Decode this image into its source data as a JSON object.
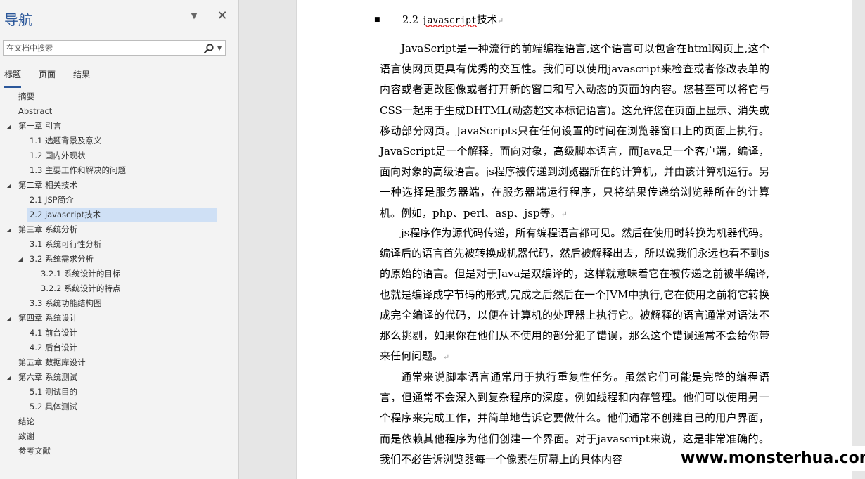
{
  "nav": {
    "title": "导航",
    "close": "✕",
    "menu": "▼",
    "search_placeholder": "在文档中搜索",
    "search_dropdown": "▼",
    "tabs": [
      "标题",
      "页面",
      "结果"
    ],
    "active_tab": "标题",
    "items": [
      {
        "label": "摘要",
        "level": 1
      },
      {
        "label": "Abstract",
        "level": 1
      },
      {
        "label": "第一章 引言",
        "level": 1,
        "expanded": true
      },
      {
        "label": "1.1 选题背景及意义",
        "level": 2
      },
      {
        "label": "1.2 国内外现状",
        "level": 2
      },
      {
        "label": "1.3 主要工作和解决的问题",
        "level": 2
      },
      {
        "label": "第二章 相关技术",
        "level": 1,
        "expanded": true
      },
      {
        "label": "2.1 JSP简介",
        "level": 2
      },
      {
        "label": "2.2 javascript技术",
        "level": 2,
        "selected": true
      },
      {
        "label": "第三章 系统分析",
        "level": 1,
        "expanded": true
      },
      {
        "label": "3.1 系统可行性分析",
        "level": 2
      },
      {
        "label": "3.2 系统需求分析",
        "level": 2,
        "expanded": true
      },
      {
        "label": "3.2.1 系统设计的目标",
        "level": 3
      },
      {
        "label": "3.2.2 系统设计的特点",
        "level": 3
      },
      {
        "label": "3.3 系统功能结构图",
        "level": 2
      },
      {
        "label": "第四章 系统设计",
        "level": 1,
        "expanded": true
      },
      {
        "label": "4.1 前台设计",
        "level": 2
      },
      {
        "label": "4.2 后台设计",
        "level": 2
      },
      {
        "label": "第五章 数据库设计",
        "level": 1
      },
      {
        "label": "第六章 系统测试",
        "level": 1,
        "expanded": true
      },
      {
        "label": "5.1 测试目的",
        "level": 2
      },
      {
        "label": "5.2 具体测试",
        "level": 2
      },
      {
        "label": "结论",
        "level": 1
      },
      {
        "label": "致谢",
        "level": 1
      },
      {
        "label": "参考文献",
        "level": 1
      }
    ]
  },
  "document": {
    "heading_num": "2.2",
    "heading_en": "javascript",
    "heading_cn": "技术",
    "paragraph_mark": "↵",
    "paragraphs": [
      "JavaScript是一种流行的前端编程语言,这个语言可以包含在html网页上,这个语言使网页更具有优秀的交互性。我们可以使用javascript来检查或者修改表单的内容或者更改图像或者打开新的窗口和写入动态的页面的内容。您甚至可以将它与CSS一起用于生成DHTML(动态超文本标记语言)。这允许您在页面上显示、消失或移动部分网页。JavaScripts只在任何设置的时间在浏览器窗口上的页面上执行。JavaScript是一个解释，面向对象，高级脚本语言，而Java是一个客户端，编译，面向对象的高级语言。js程序被传递到浏览器所在的计算机，并由该计算机运行。另一种选择是服务器端，在服务器端运行程序，只将结果传递给浏览器所在的计算机。例如，php、perl、asp、jsp等。",
      "js程序作为源代码传递，所有编程语言都可见。然后在使用时转换为机器代码。编译后的语言首先被转换成机器代码，然后被解释出去，所以说我们永远也看不到js的原始的语言。但是对于Java是双编译的，这样就意味着它在被传递之前被半编译,也就是编译成字节码的形式,完成之后然后在一个JVM中执行,它在使用之前将它转换成完全编译的代码，以便在计算机的处理器上执行它。被解释的语言通常对语法不那么挑剔，如果你在他们从不使用的部分犯了错误，那么这个错误通常不会给你带来任何问题。",
      "通常来说脚本语言通常用于执行重复性任务。虽然它们可能是完整的编程语言，但通常不会深入到复杂程序的深度，例如线程和内存管理。他们可以使用另一个程序来完成工作，并简单地告诉它要做什么。他们通常不创建自己的用户界面，而是依赖其他程序为他们创建一个界面。对于javascript来说，这是非常准确的。我们不必告诉浏览器每一个像素在屏幕上的具体内容"
    ]
  },
  "watermark": "www.monsterhua.com"
}
